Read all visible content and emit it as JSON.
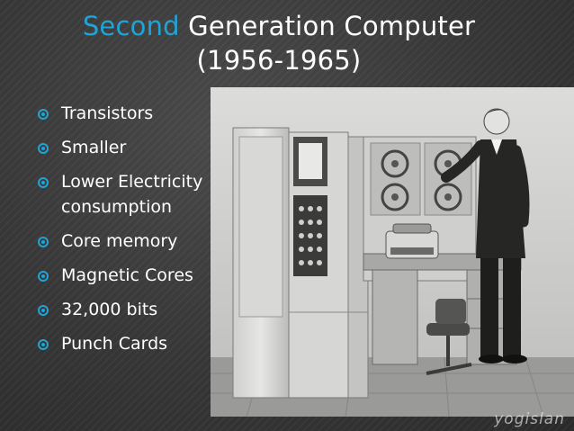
{
  "title": {
    "accent": "Second",
    "rest": " Generation Computer",
    "line2": "(1956-1965)"
  },
  "bullets": [
    "Transistors",
    "Smaller",
    "Lower Electricity consumption",
    "Core memory",
    "Magnetic Cores",
    "32,000 bits",
    "Punch Cards"
  ],
  "photo": {
    "description_icon": "second-generation-computer-photo"
  },
  "watermark": "yogislan",
  "colors": {
    "accent": "#1ea4d6",
    "background": "#363636",
    "text": "#ffffff"
  }
}
